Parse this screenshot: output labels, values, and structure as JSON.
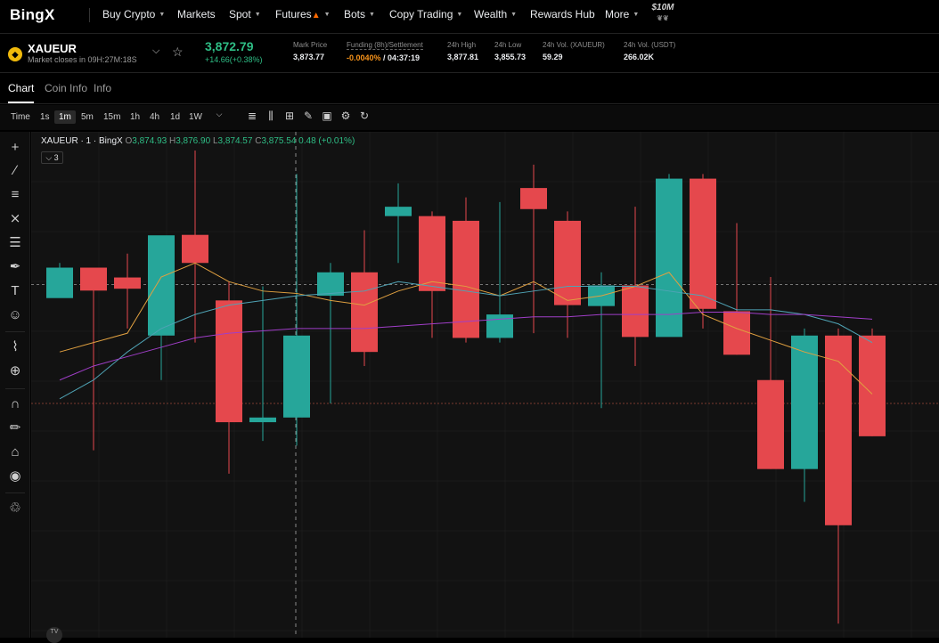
{
  "nav": {
    "logo": "BingX",
    "items": [
      {
        "label": "Buy Crypto",
        "caret": true,
        "fire": false
      },
      {
        "label": "Markets",
        "caret": false,
        "fire": false
      },
      {
        "label": "Spot",
        "caret": true,
        "fire": false
      },
      {
        "label": "Futures",
        "caret": true,
        "fire": true
      },
      {
        "label": "Bots",
        "caret": true,
        "fire": false
      },
      {
        "label": "Copy Trading",
        "caret": true,
        "fire": false
      },
      {
        "label": "Wealth",
        "caret": true,
        "fire": false
      },
      {
        "label": "Rewards Hub",
        "caret": false,
        "fire": false
      },
      {
        "label": "More",
        "caret": true,
        "fire": false
      }
    ],
    "badge": "$10M"
  },
  "ticker": {
    "symbol": "XAUEUR",
    "closes_label": "Market closes in",
    "closes_time": "09H:27M:18S",
    "last_price": "3,872.79",
    "change": "+14.66(+0.38%)",
    "stats": [
      {
        "label": "Mark Price",
        "value": "3,873.77"
      },
      {
        "label": "Funding (8h)/Settlement",
        "value_orange": "-0.0040%",
        "value": " / 04:37:19"
      },
      {
        "label": "24h High",
        "value": "3,877.81"
      },
      {
        "label": "24h Low",
        "value": "3,855.73"
      },
      {
        "label": "24h Vol. (XAUEUR)",
        "value": "59.29"
      },
      {
        "label": "24h Vol. (USDT)",
        "value": "266.02K"
      }
    ]
  },
  "tabs": [
    "Chart",
    "Coin Info",
    "Info"
  ],
  "toolbar": {
    "timeframes": [
      "Time",
      "1s",
      "1m",
      "5m",
      "15m",
      "1h",
      "4h",
      "1d",
      "1W"
    ],
    "active_timeframe": "1m"
  },
  "legend": {
    "title": "XAUEUR · 1 · BingX",
    "o_label": "O",
    "o": "3,874.93",
    "h_label": "H",
    "h": "3,876.90",
    "l_label": "L",
    "l": "3,874.57",
    "c_label": "C",
    "c": "3,875.54",
    "chg": "0.48 (+0.01%)",
    "collapse": "3"
  },
  "colors": {
    "up": "#26a69a",
    "down": "#e5484d",
    "ma1": "#e0a040",
    "ma2": "#4fa3b5",
    "ma3": "#a03ec8",
    "accent": "#2ebd85"
  },
  "chart_data": {
    "type": "candlestick",
    "symbol": "XAUEUR",
    "interval": "1m",
    "candles": [
      {
        "o": 3875.25,
        "c": 3875.9,
        "h": 3876.0,
        "l": 3875.8
      },
      {
        "o": 3875.9,
        "c": 3875.41,
        "h": 3875.6,
        "l": 3872.0
      },
      {
        "o": 3875.69,
        "c": 3875.45,
        "h": 3876.2,
        "l": 3874.6
      },
      {
        "o": 3874.45,
        "c": 3876.59,
        "h": 3876.5,
        "l": 3873.5
      },
      {
        "o": 3876.6,
        "c": 3876.0,
        "h": 3878.4,
        "l": 3874.3
      },
      {
        "o": 3875.2,
        "c": 3872.6,
        "h": 3875.6,
        "l": 3871.5
      },
      {
        "o": 3872.6,
        "c": 3872.7,
        "h": 3875.5,
        "l": 3872.2
      },
      {
        "o": 3872.7,
        "c": 3874.45,
        "h": 3877.9,
        "l": 3872.1
      },
      {
        "o": 3875.3,
        "c": 3875.8,
        "h": 3876.0,
        "l": 3873.0
      },
      {
        "o": 3875.8,
        "c": 3874.1,
        "h": 3876.7,
        "l": 3873.8
      },
      {
        "o": 3877.0,
        "c": 3877.2,
        "h": 3877.7,
        "l": 3876.0
      },
      {
        "o": 3877.0,
        "c": 3875.4,
        "h": 3877.1,
        "l": 3874.4
      },
      {
        "o": 3876.9,
        "c": 3874.4,
        "h": 3877.4,
        "l": 3874.3
      },
      {
        "o": 3874.4,
        "c": 3874.9,
        "h": 3877.3,
        "l": 3874.3
      },
      {
        "o": 3877.6,
        "c": 3877.15,
        "h": 3878.1,
        "l": 3874.5
      },
      {
        "o": 3876.9,
        "c": 3875.1,
        "h": 3877.1,
        "l": 3874.4
      },
      {
        "o": 3875.08,
        "c": 3875.52,
        "h": 3875.8,
        "l": 3872.9
      },
      {
        "o": 3875.52,
        "c": 3874.42,
        "h": 3877.2,
        "l": 3873.8
      },
      {
        "o": 3874.42,
        "c": 3877.8,
        "h": 3877.9,
        "l": 3875.4
      },
      {
        "o": 3877.8,
        "c": 3875.02,
        "h": 3877.9,
        "l": 3874.6
      },
      {
        "o": 3874.97,
        "c": 3874.04,
        "h": 3876.85,
        "l": 3874.04
      },
      {
        "o": 3873.5,
        "c": 3871.6,
        "h": 3875.7,
        "l": 3871.6
      },
      {
        "o": 3871.6,
        "c": 3874.45,
        "h": 3874.6,
        "l": 3870.9
      },
      {
        "o": 3874.45,
        "c": 3870.4,
        "h": 3874.6,
        "l": 3868.3
      },
      {
        "o": 3874.45,
        "c": 3872.3,
        "h": 3874.6,
        "l": 3872.3
      }
    ],
    "ma_lines": [
      {
        "name": "ma1",
        "values": [
          3874.1,
          3874.3,
          3874.5,
          3875.7,
          3876.0,
          3875.6,
          3875.4,
          3875.35,
          3875.2,
          3875.1,
          3875.4,
          3875.6,
          3875.5,
          3875.3,
          3875.6,
          3875.2,
          3875.3,
          3875.5,
          3875.8,
          3874.9,
          3874.6,
          3874.35,
          3874.1,
          3873.9,
          3873.2
        ]
      },
      {
        "name": "ma2",
        "values": [
          3873.1,
          3873.5,
          3874.1,
          3874.6,
          3874.9,
          3875.1,
          3875.2,
          3875.3,
          3875.35,
          3875.4,
          3875.6,
          3875.5,
          3875.4,
          3875.3,
          3875.4,
          3875.5,
          3875.5,
          3875.5,
          3875.4,
          3875.3,
          3875.0,
          3875.0,
          3874.9,
          3874.7,
          3874.3
        ]
      },
      {
        "name": "ma3",
        "values": [
          3873.5,
          3873.8,
          3874.0,
          3874.2,
          3874.4,
          3874.5,
          3874.55,
          3874.6,
          3874.6,
          3874.6,
          3874.65,
          3874.7,
          3874.75,
          3874.8,
          3874.85,
          3874.85,
          3874.9,
          3874.9,
          3874.9,
          3874.95,
          3874.95,
          3874.9,
          3874.9,
          3874.85,
          3874.8
        ]
      }
    ],
    "current_price_line": 3875.54,
    "lower_dotted_line": 3873.0,
    "ylim": [
      3868.0,
      3878.8
    ],
    "grid": true
  }
}
